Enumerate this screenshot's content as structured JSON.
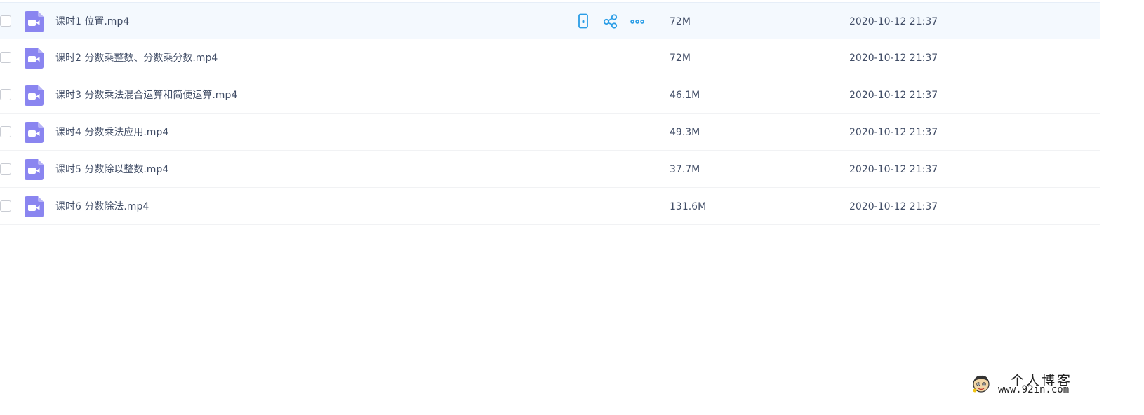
{
  "files": [
    {
      "name": "课时1 位置.mp4",
      "size": "72M",
      "date": "2020-10-12 21:37",
      "icon": "video-file-icon"
    },
    {
      "name": "课时2 分数乘整数、分数乘分数.mp4",
      "size": "72M",
      "date": "2020-10-12 21:37",
      "icon": "video-file-icon"
    },
    {
      "name": "课时3 分数乘法混合运算和简便运算.mp4",
      "size": "46.1M",
      "date": "2020-10-12 21:37",
      "icon": "video-file-icon"
    },
    {
      "name": "课时4 分数乘法应用.mp4",
      "size": "49.3M",
      "date": "2020-10-12 21:37",
      "icon": "video-file-icon"
    },
    {
      "name": "课时5 分数除以整数.mp4",
      "size": "37.7M",
      "date": "2020-10-12 21:37",
      "icon": "video-file-icon"
    },
    {
      "name": "课时6 分数除法.mp4",
      "size": "131.6M",
      "date": "2020-10-12 21:37",
      "icon": "video-file-icon"
    }
  ],
  "row_actions": [
    {
      "icon": "phone-icon"
    },
    {
      "icon": "share-icon"
    },
    {
      "icon": "more-icon"
    }
  ],
  "watermark": {
    "title": "个人博客",
    "url": "www.92in.com"
  },
  "colors": {
    "accent": "#2a9de6",
    "file_icon": "#8a85f0",
    "text": "#424e67",
    "hover_row": "#f4f9fe"
  }
}
